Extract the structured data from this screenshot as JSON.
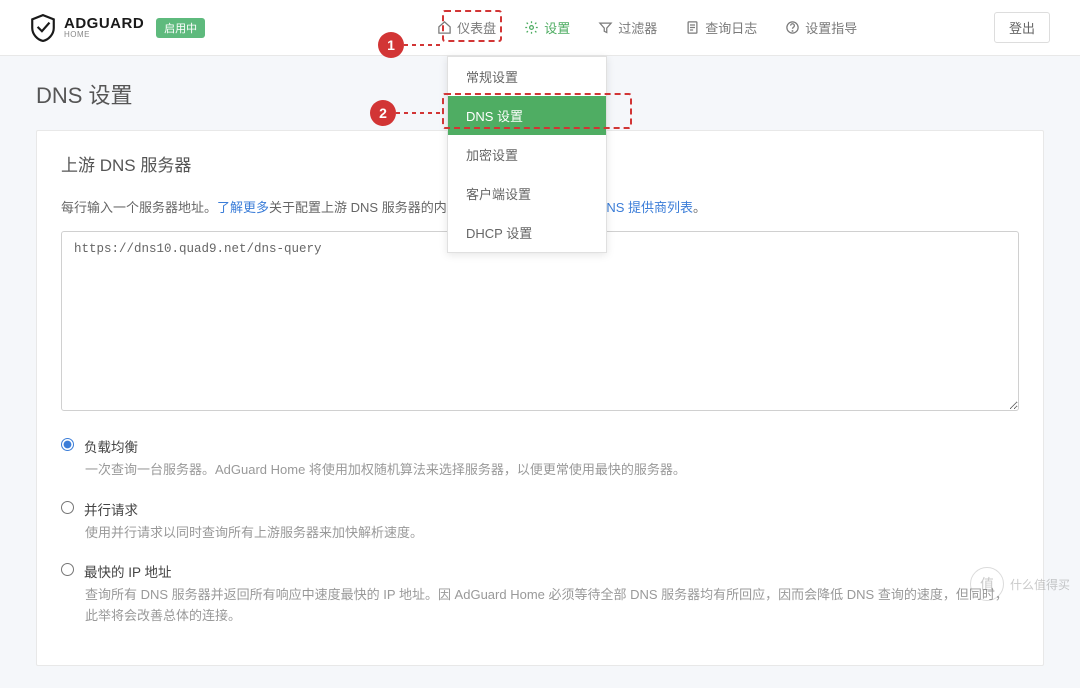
{
  "brand": {
    "main": "ADGUARD",
    "sub": "HOME"
  },
  "status": "启用中",
  "nav": {
    "dashboard": "仪表盘",
    "settings": "设置",
    "filters": "过滤器",
    "querylog": "查询日志",
    "guide": "设置指导"
  },
  "logout": "登出",
  "dropdown": {
    "general": "常规设置",
    "dns": "DNS 设置",
    "encryption": "加密设置",
    "clients": "客户端设置",
    "dhcp": "DHCP 设置"
  },
  "marker1": "1",
  "marker2": "2",
  "page_title": "DNS 设置",
  "card_title": "上游 DNS 服务器",
  "helper_pre": "每行输入一个服务器地址。",
  "helper_link1": "了解更多",
  "helper_mid": "关于配置上游 DNS 服务器的内容 此为可以下选择的",
  "helper_link2": "已知 DNS 提供商列表",
  "helper_end": "。",
  "textarea_value": "https://dns10.quad9.net/dns-query",
  "radios": {
    "lb_label": "负载均衡",
    "lb_desc": "一次查询一台服务器。AdGuard Home 将使用加权随机算法来选择服务器，以便更常使用最快的服务器。",
    "par_label": "并行请求",
    "par_desc": "使用并行请求以同时查询所有上游服务器来加快解析速度。",
    "fast_label": "最快的 IP 地址",
    "fast_desc": "查询所有 DNS 服务器并返回所有响应中速度最快的 IP 地址。因 AdGuard Home 必须等待全部 DNS 服务器均有所回应，因而会降低 DNS 查询的速度，但同时，此举将会改善总体的连接。"
  },
  "watermark_inner": "值",
  "watermark_text": "什么值得买"
}
